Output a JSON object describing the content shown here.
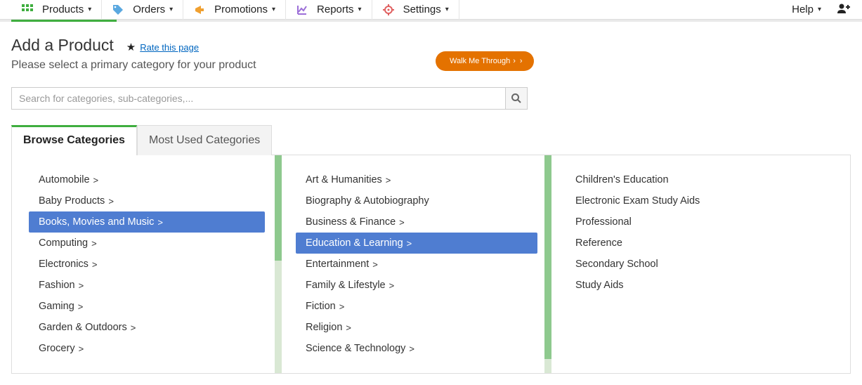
{
  "nav": {
    "items": [
      {
        "label": "Products"
      },
      {
        "label": "Orders"
      },
      {
        "label": "Promotions"
      },
      {
        "label": "Reports"
      },
      {
        "label": "Settings"
      }
    ],
    "help": "Help"
  },
  "page": {
    "title": "Add a Product",
    "rate": "Rate this page",
    "subtitle": "Please select a primary category for your product",
    "walk": "Walk Me Through",
    "search_placeholder": "Search for categories, sub-categories,..."
  },
  "tabs": {
    "browse": "Browse Categories",
    "most_used": "Most Used Categories"
  },
  "col1": [
    {
      "label": "Automobile",
      "has_children": true
    },
    {
      "label": "Baby Products",
      "has_children": true
    },
    {
      "label": "Books, Movies and Music",
      "has_children": true,
      "selected": true
    },
    {
      "label": "Computing",
      "has_children": true
    },
    {
      "label": "Electronics",
      "has_children": true
    },
    {
      "label": "Fashion",
      "has_children": true
    },
    {
      "label": "Gaming",
      "has_children": true
    },
    {
      "label": "Garden & Outdoors",
      "has_children": true
    },
    {
      "label": "Grocery",
      "has_children": true
    }
  ],
  "col2": [
    {
      "label": "Art & Humanities",
      "has_children": true
    },
    {
      "label": "Biography & Autobiography",
      "has_children": false
    },
    {
      "label": "Business & Finance",
      "has_children": true
    },
    {
      "label": "Education & Learning",
      "has_children": true,
      "selected": true
    },
    {
      "label": "Entertainment",
      "has_children": true
    },
    {
      "label": "Family & Lifestyle",
      "has_children": true
    },
    {
      "label": "Fiction",
      "has_children": true
    },
    {
      "label": "Religion",
      "has_children": true
    },
    {
      "label": "Science & Technology",
      "has_children": true
    }
  ],
  "col3": [
    {
      "label": "Children's Education",
      "has_children": false
    },
    {
      "label": "Electronic Exam Study Aids",
      "has_children": false
    },
    {
      "label": "Professional",
      "has_children": false
    },
    {
      "label": "Reference",
      "has_children": false
    },
    {
      "label": "Secondary School",
      "has_children": false
    },
    {
      "label": "Study Aids",
      "has_children": false
    }
  ]
}
